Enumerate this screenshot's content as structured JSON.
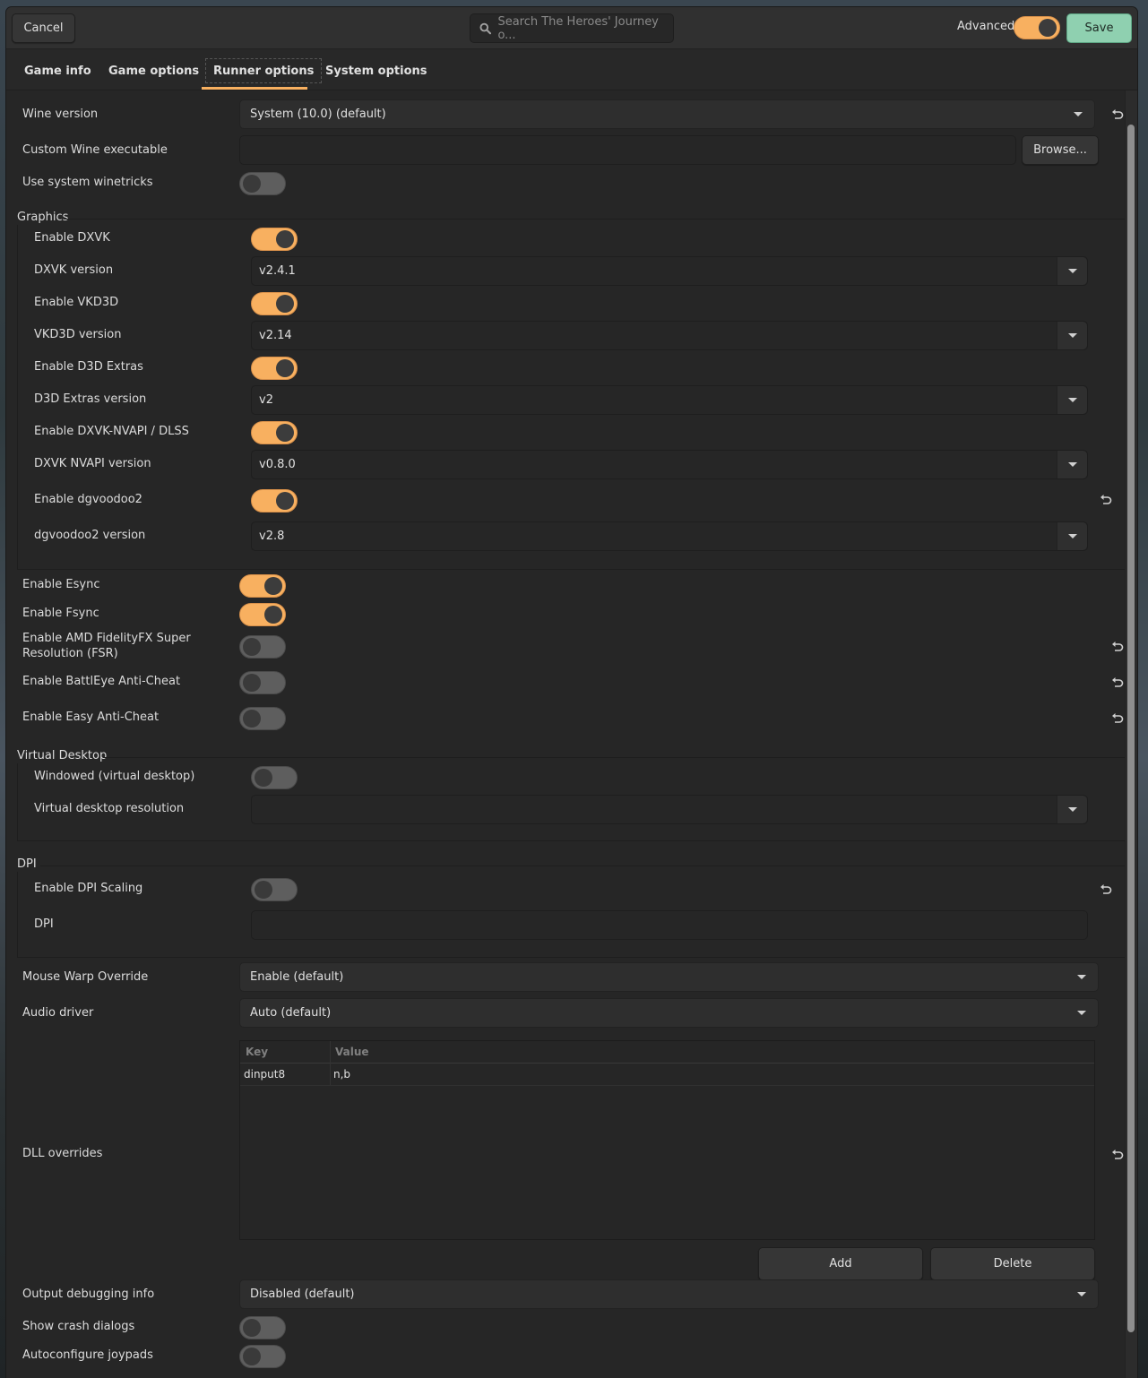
{
  "header": {
    "cancel_label": "Cancel",
    "search_placeholder": "Search The Heroes' Journey o...",
    "advanced_label": "Advanced",
    "advanced_on": true,
    "save_label": "Save"
  },
  "tabs": [
    {
      "label": "Game info",
      "active": false
    },
    {
      "label": "Game options",
      "active": false
    },
    {
      "label": "Runner options",
      "active": true
    },
    {
      "label": "System options",
      "active": false
    }
  ],
  "colors": {
    "accent": "#f8b060",
    "save": "#8fd0b0",
    "background": "#262626"
  },
  "options": {
    "wine_version": {
      "label": "Wine version",
      "value": "System (10.0) (default)"
    },
    "custom_wine": {
      "label": "Custom Wine executable",
      "value": "",
      "browse_label": "Browse..."
    },
    "system_winetricks": {
      "label": "Use system winetricks",
      "on": false
    },
    "esync": {
      "label": "Enable Esync",
      "on": true
    },
    "fsync": {
      "label": "Enable Fsync",
      "on": true
    },
    "fsr": {
      "label_line1": "Enable AMD FidelityFX Super",
      "label_line2": "Resolution (FSR)",
      "on": false
    },
    "battleye": {
      "label": "Enable BattlEye Anti-Cheat",
      "on": false
    },
    "eac": {
      "label": "Enable Easy Anti-Cheat",
      "on": false
    },
    "mouse_warp": {
      "label": "Mouse Warp Override",
      "value": "Enable (default)"
    },
    "audio_driver": {
      "label": "Audio driver",
      "value": "Auto (default)"
    },
    "dll_overrides": {
      "label": "DLL overrides",
      "columns": [
        "Key",
        "Value"
      ],
      "rows": [
        {
          "key": "dinput8",
          "value": "n,b"
        }
      ],
      "add_label": "Add",
      "delete_label": "Delete"
    },
    "debug_output": {
      "label": "Output debugging info",
      "value": "Disabled (default)"
    },
    "crash_dialogs": {
      "label": "Show crash dialogs",
      "on": false
    },
    "joypads": {
      "label": "Autoconfigure joypads",
      "on": false
    }
  },
  "graphics": {
    "title": "Graphics",
    "dxvk": {
      "label": "Enable DXVK",
      "on": true
    },
    "dxvk_version": {
      "label": "DXVK version",
      "value": "v2.4.1"
    },
    "vkd3d": {
      "label": "Enable VKD3D",
      "on": true
    },
    "vkd3d_version": {
      "label": "VKD3D version",
      "value": "v2.14"
    },
    "d3d_extras": {
      "label": "Enable D3D Extras",
      "on": true
    },
    "d3d_extras_version": {
      "label": "D3D Extras version",
      "value": "v2"
    },
    "nvapi": {
      "label": "Enable DXVK-NVAPI / DLSS",
      "on": true
    },
    "nvapi_version": {
      "label": "DXVK NVAPI version",
      "value": "v0.8.0"
    },
    "dgvoodoo": {
      "label": "Enable dgvoodoo2",
      "on": true
    },
    "dgvoodoo_version": {
      "label": "dgvoodoo2 version",
      "value": "v2.8"
    }
  },
  "virtual_desktop": {
    "title": "Virtual Desktop",
    "windowed": {
      "label": "Windowed (virtual desktop)",
      "on": false
    },
    "resolution": {
      "label": "Virtual desktop resolution",
      "value": ""
    }
  },
  "dpi": {
    "title": "DPI",
    "scaling": {
      "label": "Enable DPI Scaling",
      "on": false
    },
    "dpi_value": {
      "label": "DPI",
      "value": ""
    }
  }
}
